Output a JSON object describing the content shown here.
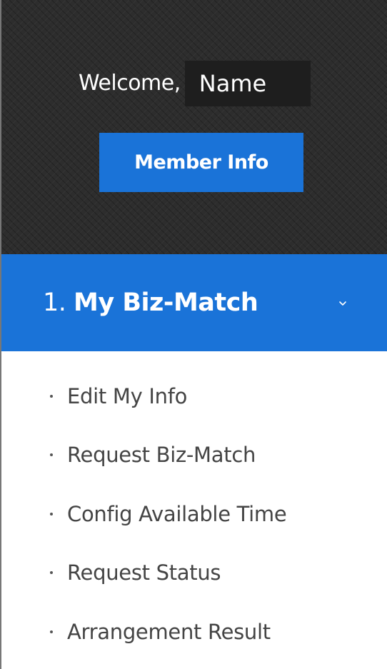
{
  "profile": {
    "welcome_label": "Welcome,",
    "name": "Name",
    "member_button_label": "Member Info"
  },
  "menu": {
    "number": "1.",
    "title": "My Biz-Match",
    "expanded": true,
    "items": [
      {
        "label": "Edit My Info"
      },
      {
        "label": "Request Biz-Match"
      },
      {
        "label": "Config Available Time"
      },
      {
        "label": "Request Status"
      },
      {
        "label": "Arrangement Result"
      }
    ]
  },
  "colors": {
    "accent": "#1a73d8",
    "panel_background": "#2d2d2d",
    "menu_text": "#444444"
  }
}
